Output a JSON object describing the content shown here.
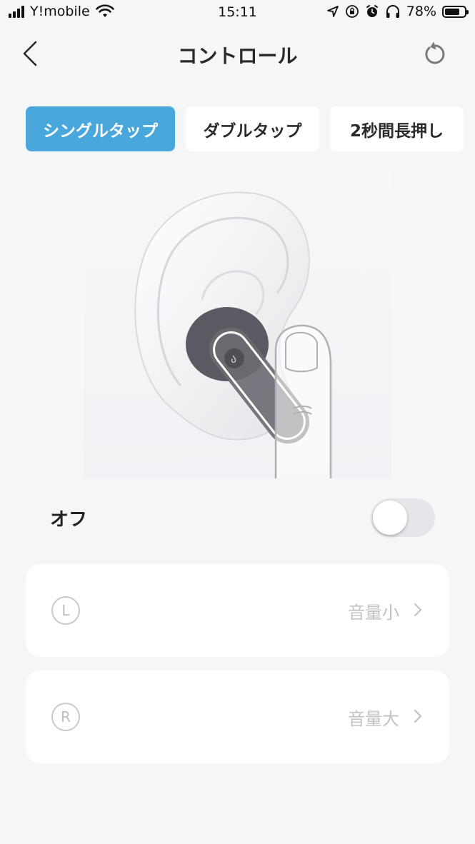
{
  "status_bar": {
    "carrier": "Y!mobile",
    "time": "15:11",
    "battery_percent": "78%",
    "battery_level": 0.78
  },
  "nav": {
    "title": "コントロール",
    "back_icon": "chevron-left-icon",
    "reset_icon": "reset-icon"
  },
  "tabs": [
    {
      "label": "シングルタップ",
      "active": true
    },
    {
      "label": "ダブルタップ",
      "active": false
    },
    {
      "label": "2秒間長押し",
      "active": false
    }
  ],
  "toggle": {
    "label": "オフ",
    "on": false
  },
  "controls": [
    {
      "side": "L",
      "value": "音量小"
    },
    {
      "side": "R",
      "value": "音量大"
    }
  ],
  "colors": {
    "accent": "#4aa7dc",
    "background": "#f5f6f8",
    "card": "#ffffff",
    "muted_text": "#c2c2c2"
  }
}
